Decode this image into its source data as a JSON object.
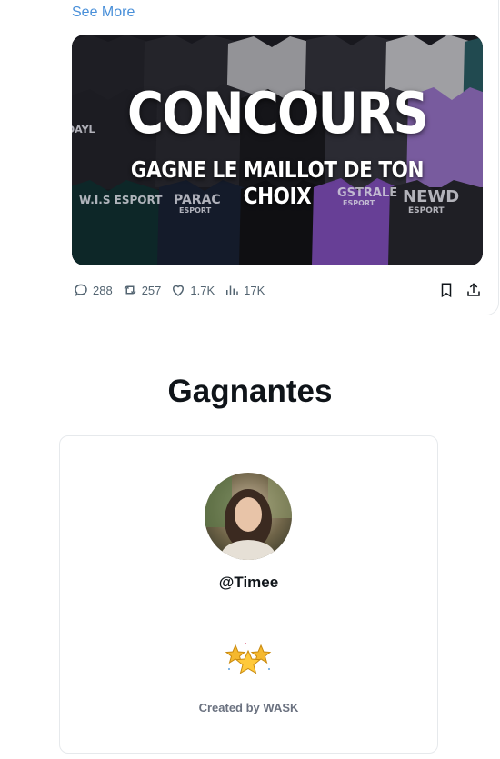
{
  "tweet": {
    "see_more": "See More",
    "media": {
      "title": "CONCOURS",
      "subtitle": "GAGNE LE MAILLOT DE TON CHOIX",
      "jersey_labels": [
        "DAYL",
        "W.I.S ESPORT",
        "PARAC",
        "ESPORT",
        "GSTRALE",
        "ESPORT",
        "NEWD",
        "ESPORT"
      ]
    },
    "stats": {
      "replies": "288",
      "retweets": "257",
      "likes": "1.7K",
      "views": "17K"
    }
  },
  "winners": {
    "title": "Gagnantes",
    "handle": "@Timee",
    "created_by": "Created by WASK"
  },
  "colors": {
    "link": "#4a90d9",
    "muted": "#536471",
    "star": "#f5b82e",
    "purple_jersey": "#8a55c9"
  }
}
